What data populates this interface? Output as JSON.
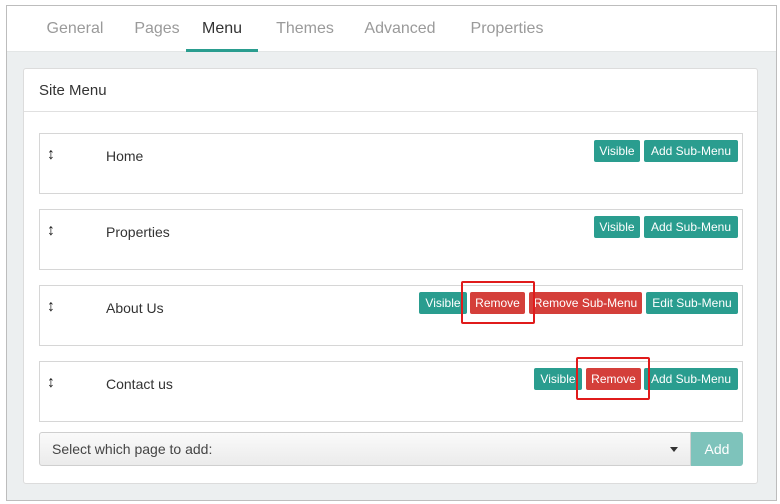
{
  "tabs": [
    {
      "label": "General"
    },
    {
      "label": "Pages"
    },
    {
      "label": "Menu"
    },
    {
      "label": "Themes"
    },
    {
      "label": "Advanced"
    },
    {
      "label": "Properties"
    }
  ],
  "active_tab": "Menu",
  "panel": {
    "title": "Site Menu"
  },
  "menu_items": [
    {
      "label": "Home",
      "buttons": [
        "Visible",
        "Add Sub-Menu"
      ]
    },
    {
      "label": "Properties",
      "buttons": [
        "Visible",
        "Add Sub-Menu"
      ]
    },
    {
      "label": "About Us",
      "buttons": [
        "Visible",
        "Remove",
        "Remove Sub-Menu",
        "Edit Sub-Menu"
      ]
    },
    {
      "label": "Contact us",
      "buttons": [
        "Visible",
        "Remove",
        "Add Sub-Menu"
      ]
    }
  ],
  "drag_icon": "↕",
  "add_page": {
    "placeholder": "Select which page to add:",
    "button": "Add"
  },
  "colors": {
    "teal": "#2a9d8f",
    "red": "#d43f3a",
    "highlight": "#e01b1b",
    "add_disabled": "#7ec3bb"
  }
}
